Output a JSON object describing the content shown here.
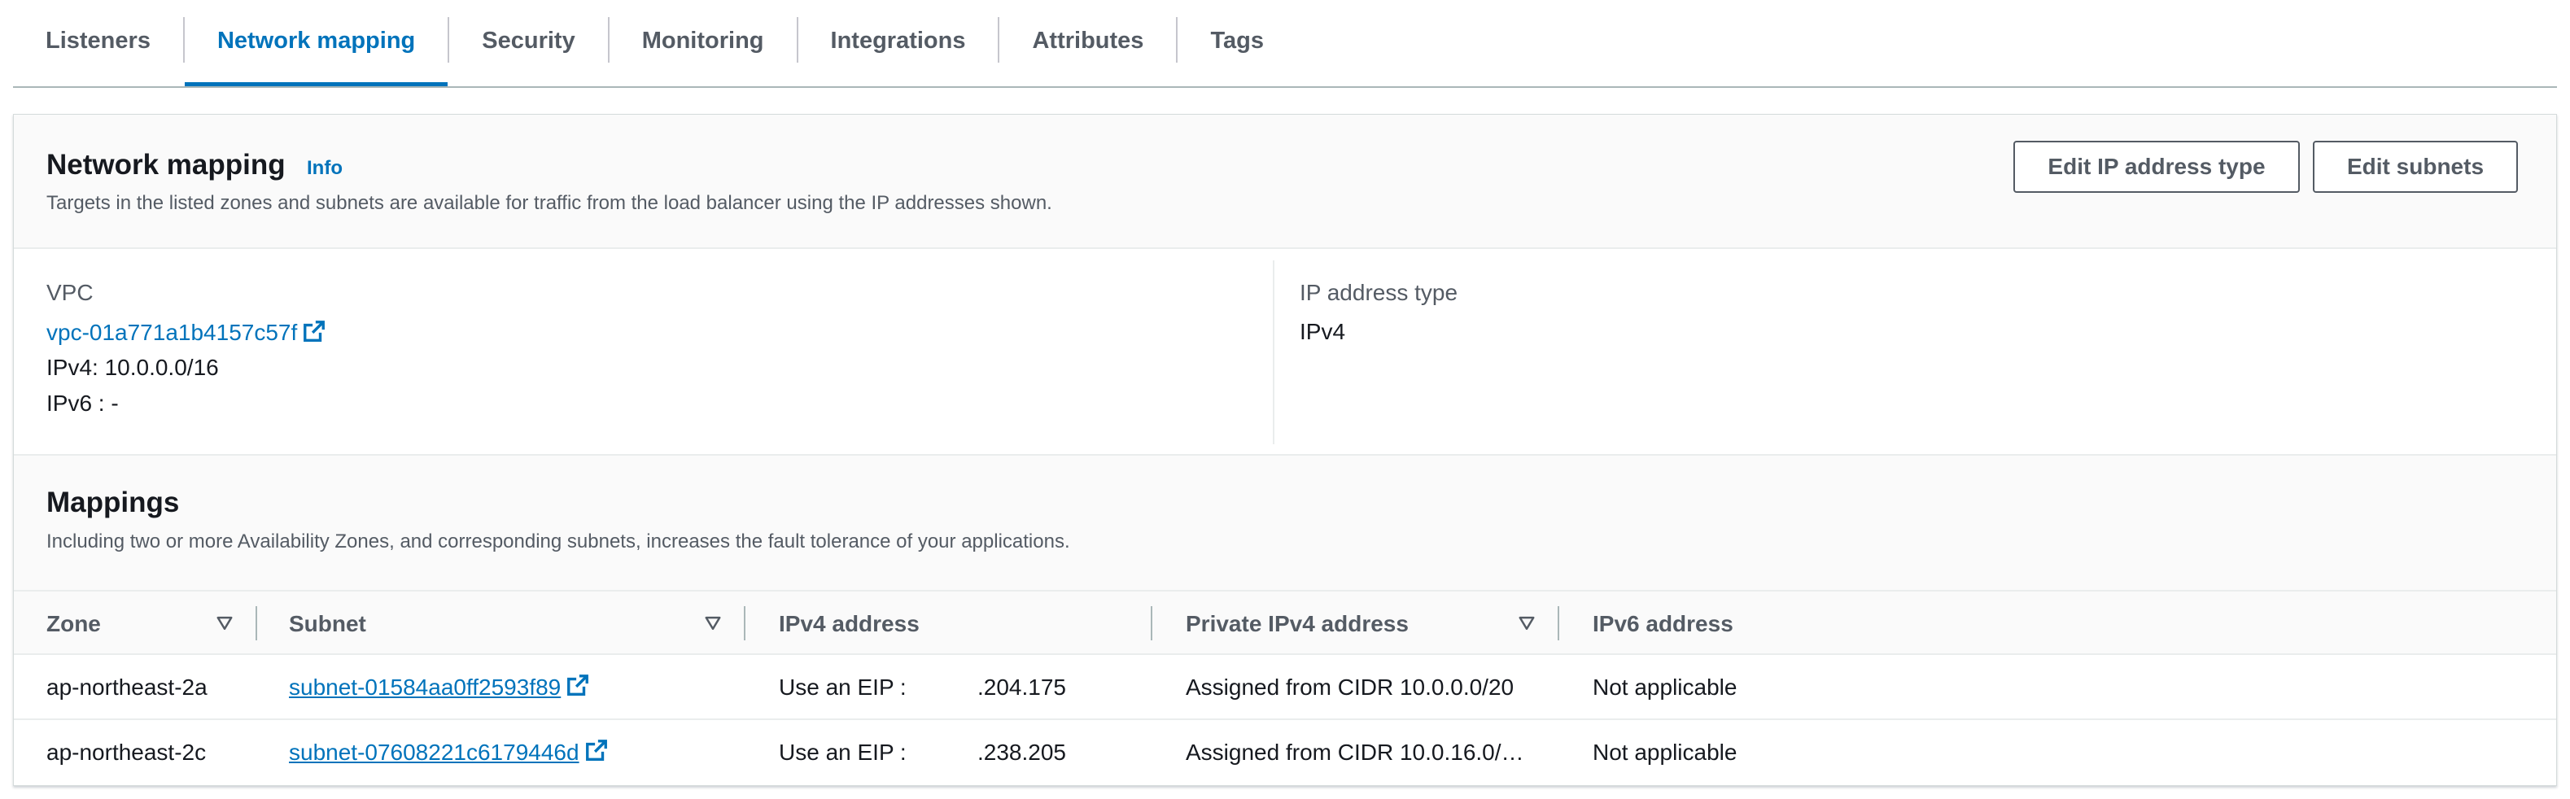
{
  "tabs": [
    {
      "label": "Listeners",
      "active": false
    },
    {
      "label": "Network mapping",
      "active": true
    },
    {
      "label": "Security",
      "active": false
    },
    {
      "label": "Monitoring",
      "active": false
    },
    {
      "label": "Integrations",
      "active": false
    },
    {
      "label": "Attributes",
      "active": false
    },
    {
      "label": "Tags",
      "active": false
    }
  ],
  "network_mapping": {
    "title": "Network mapping",
    "info_label": "Info",
    "description": "Targets in the listed zones and subnets are available for traffic from the load balancer using the IP addresses shown.",
    "edit_ip_button": "Edit IP address type",
    "edit_subnets_button": "Edit subnets",
    "vpc": {
      "label": "VPC",
      "id": "vpc-01a771a1b4157c57f",
      "ipv4": "IPv4: 10.0.0.0/16",
      "ipv6": "IPv6 : -"
    },
    "ip_address_type": {
      "label": "IP address type",
      "value": "IPv4"
    }
  },
  "mappings": {
    "title": "Mappings",
    "description": "Including two or more Availability Zones, and corresponding subnets, increases the fault tolerance of your applications.",
    "columns": [
      "Zone",
      "Subnet",
      "IPv4 address",
      "Private IPv4 address",
      "IPv6 address"
    ],
    "rows": [
      {
        "zone": "ap-northeast-2a",
        "subnet": "subnet-01584aa0ff2593f89",
        "ipv4_prefix": "Use an EIP :",
        "ipv4_value": ".204.175",
        "private_ipv4": "Assigned from CIDR 10.0.0.0/20",
        "ipv6": "Not applicable"
      },
      {
        "zone": "ap-northeast-2c",
        "subnet": "subnet-07608221c6179446d",
        "ipv4_prefix": "Use an EIP :",
        "ipv4_value": ".238.205",
        "private_ipv4": "Assigned from CIDR 10.0.16.0/…",
        "ipv6": "Not applicable"
      }
    ]
  },
  "colors": {
    "accent": "#0073bb",
    "text": "#16191f",
    "muted": "#545b64"
  }
}
